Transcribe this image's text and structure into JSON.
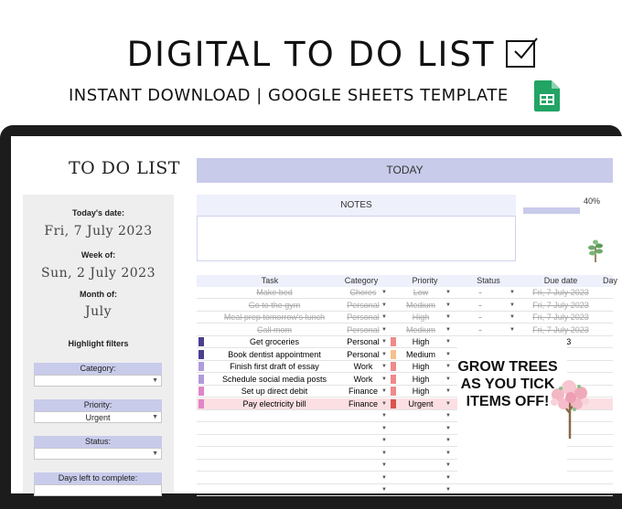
{
  "banner": {
    "headline": "DIGITAL TO DO LIST",
    "subline": "INSTANT DOWNLOAD | GOOGLE SHEETS TEMPLATE"
  },
  "sheet": {
    "title": "TO DO LIST",
    "today_label": "TODAY",
    "notes_label": "NOTES",
    "progress": {
      "fraction": 0.4,
      "label": "40%"
    }
  },
  "left_panel": {
    "todays_date_label": "Today's date:",
    "todays_date_value": "Fri, 7 July 2023",
    "week_of_label": "Week of:",
    "week_of_value": "Sun, 2 July 2023",
    "month_of_label": "Month of:",
    "month_of_value": "July",
    "highlight_filters_label": "Highlight filters",
    "filters": [
      {
        "label": "Category:",
        "value": ""
      },
      {
        "label": "Priority:",
        "value": "Urgent"
      },
      {
        "label": "Status:",
        "value": ""
      },
      {
        "label": "Days left to complete:",
        "value": ""
      }
    ]
  },
  "table": {
    "headers": [
      "Task",
      "Category",
      "Priority",
      "Status",
      "Due date",
      "Day"
    ],
    "rows": [
      {
        "task": "Make bed",
        "category": "Chores",
        "priority": "Low",
        "status": "-",
        "due": "Fri, 7 July 2023",
        "done": true,
        "cat_color": "",
        "pri_color": ""
      },
      {
        "task": "Go to the gym",
        "category": "Personal",
        "priority": "Medium",
        "status": "-",
        "due": "Fri, 7 July 2023",
        "done": true,
        "cat_color": "",
        "pri_color": ""
      },
      {
        "task": "Meal prep tomorrow's lunch",
        "category": "Personal",
        "priority": "High",
        "status": "-",
        "due": "Fri, 7 July 2023",
        "done": true,
        "cat_color": "",
        "pri_color": ""
      },
      {
        "task": "Call mom",
        "category": "Personal",
        "priority": "Medium",
        "status": "-",
        "due": "Fri, 7 July 2023",
        "done": true,
        "cat_color": "",
        "pri_color": ""
      },
      {
        "task": "Get groceries",
        "category": "Personal",
        "priority": "High",
        "status": "",
        "due": "...023",
        "done": false,
        "cat_color": "#4b3f8f",
        "pri_color": "#f08a8a"
      },
      {
        "task": "Book dentist appointment",
        "category": "Personal",
        "priority": "Medium",
        "status": "",
        "due": "",
        "done": false,
        "cat_color": "#4b3f8f",
        "pri_color": "#f7c08a"
      },
      {
        "task": "Finish first draft of essay",
        "category": "Work",
        "priority": "High",
        "status": "",
        "due": "",
        "done": false,
        "cat_color": "#b09bdc",
        "pri_color": "#f08a8a"
      },
      {
        "task": "Schedule social media posts",
        "category": "Work",
        "priority": "High",
        "status": "",
        "due": "",
        "done": false,
        "cat_color": "#b09bdc",
        "pri_color": "#f08a8a"
      },
      {
        "task": "Set up direct debit",
        "category": "Finance",
        "priority": "High",
        "status": "",
        "due": "",
        "done": false,
        "cat_color": "#e085c8",
        "pri_color": "#f08a8a"
      },
      {
        "task": "Pay electricity bill",
        "category": "Finance",
        "priority": "Urgent",
        "status": "",
        "due": "",
        "done": false,
        "cat_color": "#e085c8",
        "pri_color": "#d9534f",
        "highlight": true
      }
    ],
    "empty_rows": 7
  },
  "promo": {
    "text": "GROW TREES AS YOU TICK ITEMS OFF!"
  },
  "colors": {
    "accent": "#c8cbea",
    "highlight_row": "#fbdfe2",
    "device": "#1c1c1c"
  }
}
